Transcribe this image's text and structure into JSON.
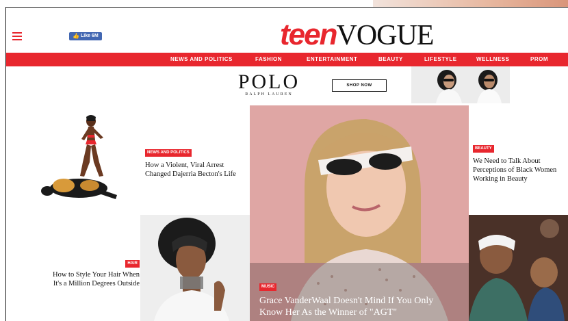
{
  "header": {
    "menu_icon": "hamburger-icon",
    "fb_like_label": "Like 6M",
    "logo_teen": "teen",
    "logo_vogue": "VOGUE"
  },
  "nav": {
    "items": [
      "NEWS AND POLITICS",
      "FASHION",
      "ENTERTAINMENT",
      "BEAUTY",
      "LIFESTYLE",
      "WELLNESS",
      "PROM"
    ]
  },
  "ad": {
    "brand": "POLO",
    "subbrand": "RALPH LAUREN",
    "cta": "SHOP NOW"
  },
  "stories": {
    "politics": {
      "tag": "NEWS AND POLITICS",
      "headline_1": "How a Violent, Viral Arrest",
      "headline_2": "Changed Dajerria Becton's Life"
    },
    "beauty": {
      "tag": "BEAUTY",
      "headline_1": "We Need to Talk About",
      "headline_2": "Perceptions of Black Women",
      "headline_3": "Working in Beauty"
    },
    "hair": {
      "tag": "HAIR",
      "headline_1": "How to Style Your Hair When",
      "headline_2": "It's a Million Degrees Outside"
    },
    "music": {
      "tag": "MUSIC",
      "headline_1": "Grace VanderWaal Doesn't Mind If You Only",
      "headline_2": "Know Her As the Winner of \"AGT\""
    }
  },
  "colors": {
    "brand_red": "#e8272e",
    "facebook_blue": "#4267b2"
  }
}
